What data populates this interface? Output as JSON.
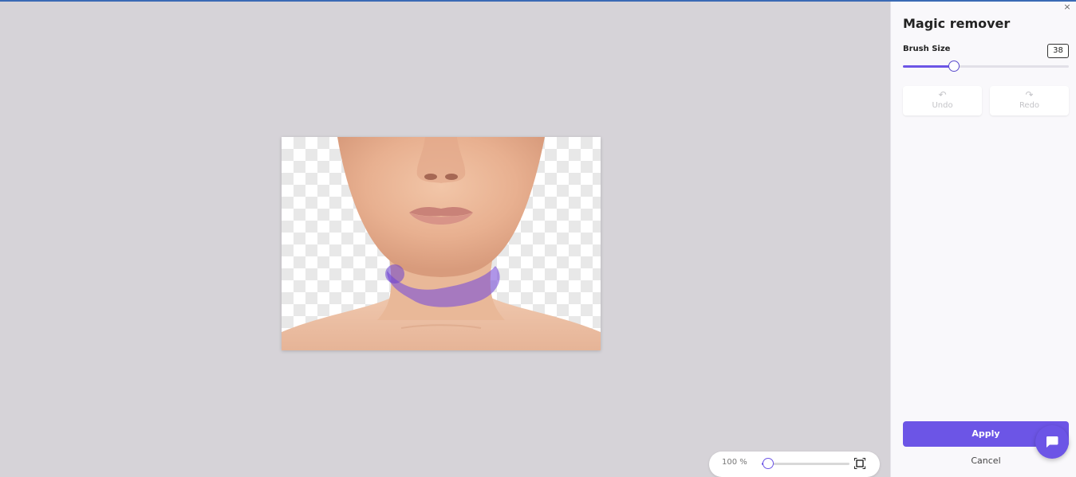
{
  "panel": {
    "title": "Magic remover",
    "close_glyph": "×",
    "brush_size_label": "Brush Size",
    "brush_size_value": "38",
    "brush_size_fraction": 0.31,
    "undo_label": "Undo",
    "redo_label": "Redo",
    "undo_glyph": "↶",
    "redo_glyph": "↷",
    "apply_label": "Apply",
    "cancel_label": "Cancel"
  },
  "zoom": {
    "label": "100 %",
    "fraction": 0.07
  },
  "icons": {
    "close": "close-icon",
    "undo": "undo-icon",
    "redo": "redo-icon",
    "fit": "fit-to-screen-icon",
    "chat": "chat-icon"
  },
  "colors": {
    "accent": "#6c55e6",
    "canvas_bg": "#d6d3d8",
    "brush_stroke": "#7a4fd9"
  }
}
